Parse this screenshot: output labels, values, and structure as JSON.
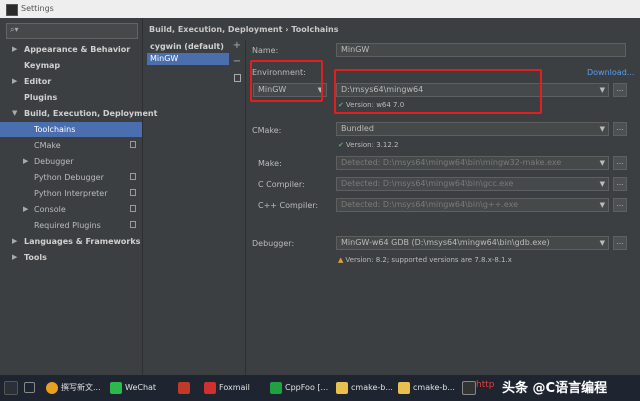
{
  "window": {
    "title": "Settings"
  },
  "search": {
    "placeholder": ""
  },
  "sidebar": {
    "items": [
      {
        "label": "Appearance & Behavior"
      },
      {
        "label": "Keymap"
      },
      {
        "label": "Editor"
      },
      {
        "label": "Plugins"
      },
      {
        "label": "Build, Execution, Deployment"
      },
      {
        "label": "Toolchains"
      },
      {
        "label": "CMake"
      },
      {
        "label": "Debugger"
      },
      {
        "label": "Python Debugger"
      },
      {
        "label": "Python Interpreter"
      },
      {
        "label": "Console"
      },
      {
        "label": "Required Plugins"
      },
      {
        "label": "Languages & Frameworks"
      },
      {
        "label": "Tools"
      }
    ]
  },
  "breadcrumb": {
    "parent": "Build, Execution, Deployment",
    "separator": "›",
    "current": "Toolchains"
  },
  "toolchains": {
    "items": [
      "cygwin (default)",
      "MinGW"
    ],
    "add": "+",
    "remove": "−"
  },
  "form": {
    "name_label": "Name:",
    "name_value": "MinGW",
    "environment_label": "Environment:",
    "download_link": "Download...",
    "environment_type": "MinGW",
    "environment_path": "D:\\msys64\\mingw64",
    "environment_version": "Version: w64 7.0",
    "cmake_label": "CMake:",
    "cmake_value": "Bundled",
    "cmake_version": "Version: 3.12.2",
    "make_label": "Make:",
    "make_value": "Detected: D:\\msys64\\mingw64\\bin\\mingw32-make.exe",
    "c_compiler_label": "C Compiler:",
    "c_compiler_value": "Detected: D:\\msys64\\mingw64\\bin\\gcc.exe",
    "cpp_compiler_label": "C++ Compiler:",
    "cpp_compiler_value": "Detected: D:\\msys64\\mingw64\\bin\\g++.exe",
    "debugger_label": "Debugger:",
    "debugger_value": "MinGW-w64 GDB (D:\\msys64\\mingw64\\bin\\gdb.exe)",
    "debugger_warning": "Version: 8.2; supported versions are 7.8.x-8.1.x",
    "browse": "..."
  },
  "taskbar": {
    "items": [
      "撰写新文...",
      "WeChat",
      "Foxmail",
      "CppFoo [...",
      "cmake-b...",
      "cmake-b..."
    ]
  },
  "watermark": {
    "text": "头条 @C语言编程",
    "url": "http"
  },
  "colors": {
    "accent": "#4b6eaf",
    "highlight": "#e02020",
    "link": "#589df6",
    "ok": "#59a869",
    "warn": "#e0a030"
  }
}
